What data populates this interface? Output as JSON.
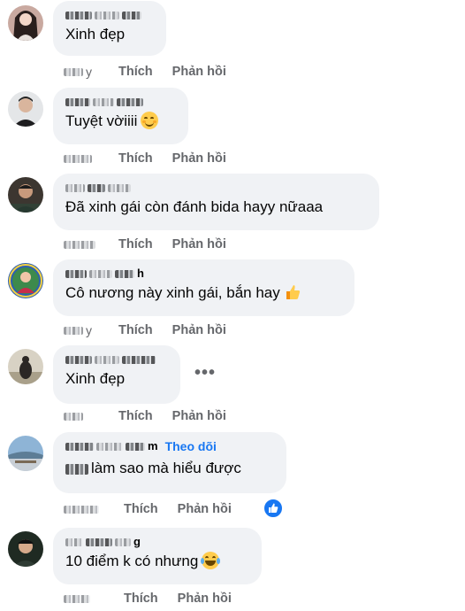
{
  "actions": {
    "like_label": "Thích",
    "reply_label": "Phản hồi"
  },
  "follow_label": "Theo dõi",
  "comments": [
    {
      "text": "Xinh đẹp",
      "emoji": "",
      "time_suffix": "y"
    },
    {
      "text": "Tuyệt vờiiii",
      "emoji": "smiling-face-icon",
      "time_suffix": ""
    },
    {
      "text": "Đã xinh gái còn đánh bida hayy nữaaa",
      "emoji": "",
      "time_suffix": ""
    },
    {
      "text": "Cô nương này xinh gái, bắn hay",
      "emoji": "thumbs-up-icon",
      "name_suffix": "h",
      "time_suffix": "y"
    },
    {
      "text": "Xinh đẹp",
      "emoji": "",
      "time_suffix": ""
    },
    {
      "text": "làm sao mà hiểu được",
      "emoji": "",
      "name_suffix": "m",
      "time_suffix": ""
    },
    {
      "text": "10 điểm k có nhưng",
      "emoji": "laughing-tears-icon",
      "name_suffix": "g",
      "time_suffix": ""
    }
  ],
  "colors": {
    "link": "#1877f2",
    "bubble": "#f0f2f5",
    "muted": "#65676b"
  }
}
